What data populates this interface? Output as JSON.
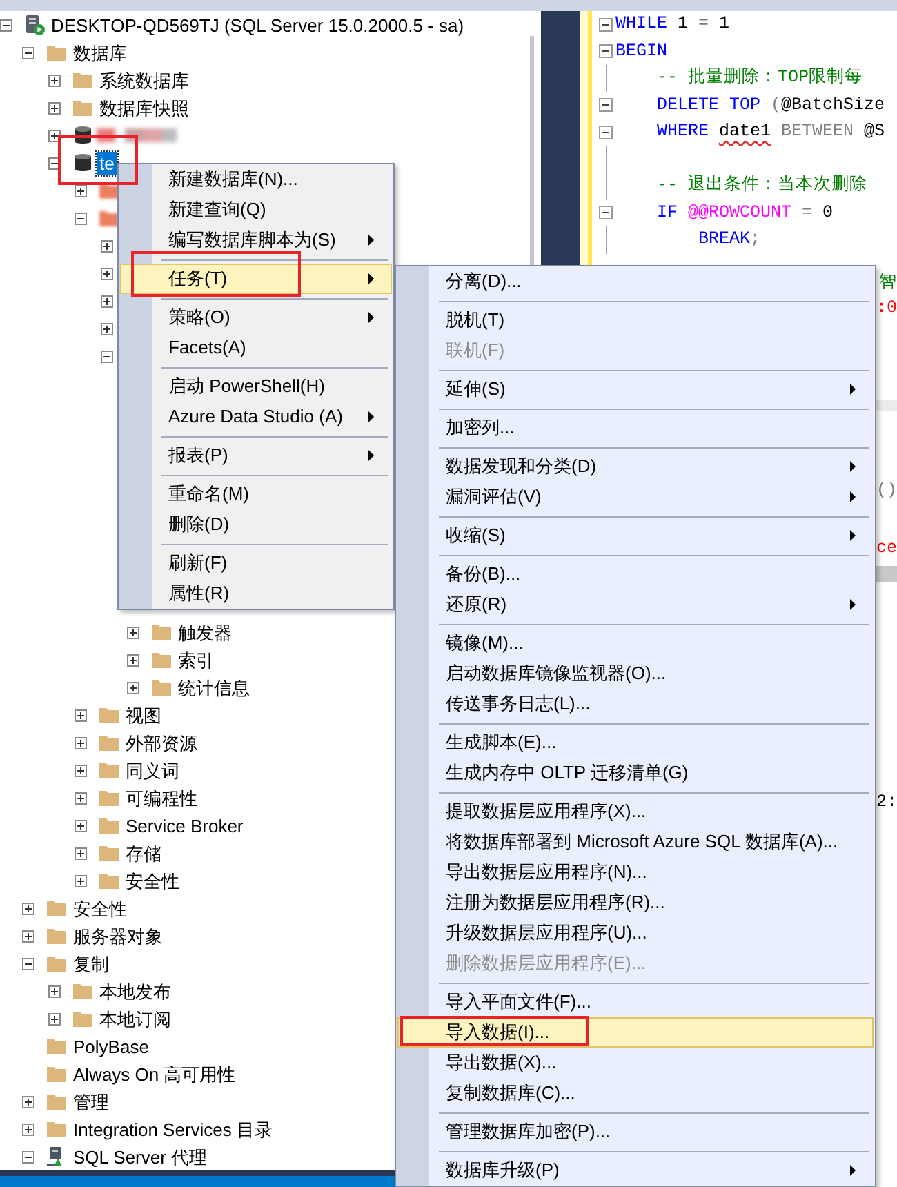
{
  "object_explorer": {
    "tree": [
      {
        "label": "DESKTOP-QD569TJ (SQL Server 15.0.2000.5 - sa)",
        "kind": "server",
        "expanded": true,
        "selected": false,
        "children": [
          {
            "label": "数据库",
            "kind": "folder",
            "expanded": true,
            "selected": false,
            "children": [
              {
                "label": "系统数据库",
                "kind": "folder",
                "expanded": false,
                "selected": false
              },
              {
                "label": "数据库快照",
                "kind": "folder",
                "expanded": false,
                "selected": false
              },
              {
                "kind": "blurreddatabase",
                "expanded": false,
                "selected": false
              },
              {
                "label": "te",
                "kind": "database",
                "expanded": true,
                "selected": true,
                "annotated": true,
                "children": [
                  {
                    "kind": "blurredfolder",
                    "expanded": false,
                    "selected": false
                  },
                  {
                    "kind": "blurredfolder",
                    "expanded": true,
                    "selected": false,
                    "children": [
                      {
                        "expanded": false,
                        "selected": false
                      },
                      {
                        "expanded": false,
                        "selected": false
                      },
                      {
                        "expanded": false,
                        "selected": false
                      },
                      {
                        "expanded": false,
                        "selected": false
                      },
                      {
                        "expanded": true,
                        "selected": false,
                        "children": [
                          {
                            "label": "触发器",
                            "kind": "folder",
                            "expanded": false,
                            "selected": false
                          },
                          {
                            "label": "索引",
                            "kind": "folder",
                            "expanded": false,
                            "selected": false
                          },
                          {
                            "label": "统计信息",
                            "kind": "folder",
                            "expanded": false,
                            "selected": false
                          }
                        ]
                      }
                    ]
                  },
                  {
                    "label": "视图",
                    "kind": "folder",
                    "expanded": false,
                    "selected": false
                  },
                  {
                    "label": "外部资源",
                    "kind": "folder",
                    "expanded": false,
                    "selected": false
                  },
                  {
                    "label": "同义词",
                    "kind": "folder",
                    "expanded": false,
                    "selected": false
                  },
                  {
                    "label": "可编程性",
                    "kind": "folder",
                    "expanded": false,
                    "selected": false
                  },
                  {
                    "label": "Service Broker",
                    "kind": "folder",
                    "expanded": false,
                    "selected": false
                  },
                  {
                    "label": "存储",
                    "kind": "folder",
                    "expanded": false,
                    "selected": false
                  },
                  {
                    "label": "安全性",
                    "kind": "folder",
                    "expanded": false,
                    "selected": false
                  }
                ]
              }
            ]
          },
          {
            "label": "安全性",
            "kind": "folder",
            "expanded": false,
            "selected": false
          },
          {
            "label": "服务器对象",
            "kind": "folder",
            "expanded": false,
            "selected": false
          },
          {
            "label": "复制",
            "kind": "folder",
            "expanded": true,
            "selected": false,
            "children": [
              {
                "label": "本地发布",
                "kind": "folder",
                "expanded": false,
                "selected": false
              },
              {
                "label": "本地订阅",
                "kind": "folder",
                "expanded": false,
                "selected": false
              }
            ]
          },
          {
            "label": "PolyBase",
            "kind": "folder",
            "selected": false
          },
          {
            "label": "Always On 高可用性",
            "kind": "folder",
            "selected": false
          },
          {
            "label": "管理",
            "kind": "folder",
            "expanded": false,
            "selected": false
          },
          {
            "label": "Integration Services 目录",
            "kind": "folder",
            "expanded": false,
            "selected": false
          },
          {
            "label": "SQL Server 代理",
            "kind": "agent",
            "expanded": true,
            "selected": false
          }
        ]
      }
    ]
  },
  "editor": {
    "lines": [
      {
        "fold": true,
        "tokens": [
          {
            "t": "WHILE",
            "kind": "keyword"
          },
          {
            "t": " 1 ",
            "kind": "plain"
          },
          {
            "t": "=",
            "kind": "operator"
          },
          {
            "t": " 1",
            "kind": "plain"
          }
        ]
      },
      {
        "fold": true,
        "tokens": [
          {
            "t": "BEGIN",
            "kind": "keyword"
          }
        ]
      },
      {
        "fold": false,
        "tokens": [
          {
            "t": "    -- 批量删除：TOP限制每",
            "kind": "comment"
          }
        ]
      },
      {
        "fold": true,
        "tokens": [
          {
            "t": "    DELETE TOP",
            "kind": "keyword"
          },
          {
            "t": " (",
            "kind": "operator"
          },
          {
            "t": "@BatchSize",
            "kind": "plain"
          }
        ]
      },
      {
        "fold": true,
        "tokens": [
          {
            "t": "    WHERE ",
            "kind": "keyword"
          },
          {
            "t": "date1",
            "kind": "plain",
            "squiggle": true
          },
          {
            "t": " BETWEEN",
            "kind": "operator"
          },
          {
            "t": " @S",
            "kind": "plain"
          }
        ]
      },
      {
        "fold": false
      },
      {
        "fold": false,
        "tokens": [
          {
            "t": "    -- 退出条件：当本次删除",
            "kind": "comment"
          }
        ]
      },
      {
        "fold": true,
        "tokens": [
          {
            "t": "    IF ",
            "kind": "keyword"
          },
          {
            "t": "@@ROWCOUNT",
            "kind": "system"
          },
          {
            "t": " = ",
            "kind": "operator"
          },
          {
            "t": "0",
            "kind": "plain"
          }
        ]
      },
      {
        "fold": false,
        "tokens": [
          {
            "t": "        BREAK",
            "kind": "keyword"
          },
          {
            "t": ";",
            "kind": "operator"
          }
        ]
      }
    ],
    "fragments": [
      {
        "t": "智",
        "kind": "comment"
      },
      {
        "t": ":0",
        "kind": "string"
      },
      {
        "t": "()",
        "kind": "operator"
      },
      {
        "t": "ce",
        "kind": "string"
      },
      {
        "t": "2:",
        "kind": "plain"
      }
    ]
  },
  "context_menus": [
    {
      "groups": [
        [
          {
            "label": "新建数据库(N)...",
            "submenu": false,
            "disabled": false,
            "selected": false
          },
          {
            "label": "新建查询(Q)",
            "submenu": false,
            "disabled": false,
            "selected": false
          },
          {
            "label": "编写数据库脚本为(S)",
            "submenu": true,
            "disabled": false,
            "selected": false
          }
        ],
        [
          {
            "label": "任务(T)",
            "submenu": true,
            "disabled": false,
            "selected": true,
            "annotated": true
          }
        ],
        [
          {
            "label": "策略(O)",
            "submenu": true,
            "disabled": false,
            "selected": false
          },
          {
            "label": "Facets(A)",
            "submenu": false,
            "disabled": false,
            "selected": false
          }
        ],
        [
          {
            "label": "启动 PowerShell(H)",
            "submenu": false,
            "disabled": false,
            "selected": false
          },
          {
            "label": "Azure Data Studio (A)",
            "submenu": true,
            "disabled": false,
            "selected": false
          }
        ],
        [
          {
            "label": "报表(P)",
            "submenu": true,
            "disabled": false,
            "selected": false
          }
        ],
        [
          {
            "label": "重命名(M)",
            "submenu": false,
            "disabled": false,
            "selected": false
          },
          {
            "label": "删除(D)",
            "submenu": false,
            "disabled": false,
            "selected": false
          }
        ],
        [
          {
            "label": "刷新(F)",
            "submenu": false,
            "disabled": false,
            "selected": false
          },
          {
            "label": "属性(R)",
            "submenu": false,
            "disabled": false,
            "selected": false
          }
        ]
      ]
    },
    {
      "groups": [
        [
          {
            "label": "分离(D)...",
            "submenu": false,
            "disabled": false,
            "selected": false
          }
        ],
        [
          {
            "label": "脱机(T)",
            "submenu": false,
            "disabled": false,
            "selected": false
          },
          {
            "label": "联机(F)",
            "submenu": false,
            "disabled": true,
            "selected": false
          }
        ],
        [
          {
            "label": "延伸(S)",
            "submenu": true,
            "disabled": false,
            "selected": false
          }
        ],
        [
          {
            "label": "加密列...",
            "submenu": false,
            "disabled": false,
            "selected": false
          }
        ],
        [
          {
            "label": "数据发现和分类(D)",
            "submenu": true,
            "disabled": false,
            "selected": false
          },
          {
            "label": "漏洞评估(V)",
            "submenu": true,
            "disabled": false,
            "selected": false
          }
        ],
        [
          {
            "label": "收缩(S)",
            "submenu": true,
            "disabled": false,
            "selected": false
          }
        ],
        [
          {
            "label": "备份(B)...",
            "submenu": false,
            "disabled": false,
            "selected": false
          },
          {
            "label": "还原(R)",
            "submenu": true,
            "disabled": false,
            "selected": false
          }
        ],
        [
          {
            "label": "镜像(M)...",
            "submenu": false,
            "disabled": false,
            "selected": false
          },
          {
            "label": "启动数据库镜像监视器(O)...",
            "submenu": false,
            "disabled": false,
            "selected": false
          },
          {
            "label": "传送事务日志(L)...",
            "submenu": false,
            "disabled": false,
            "selected": false
          }
        ],
        [
          {
            "label": "生成脚本(E)...",
            "submenu": false,
            "disabled": false,
            "selected": false
          },
          {
            "label": "生成内存中 OLTP 迁移清单(G)",
            "submenu": false,
            "disabled": false,
            "selected": false
          }
        ],
        [
          {
            "label": "提取数据层应用程序(X)...",
            "submenu": false,
            "disabled": false,
            "selected": false
          },
          {
            "label": "将数据库部署到 Microsoft Azure SQL 数据库(A)...",
            "submenu": false,
            "disabled": false,
            "selected": false
          },
          {
            "label": "导出数据层应用程序(N)...",
            "submenu": false,
            "disabled": false,
            "selected": false
          },
          {
            "label": "注册为数据层应用程序(R)...",
            "submenu": false,
            "disabled": false,
            "selected": false
          },
          {
            "label": "升级数据层应用程序(U)...",
            "submenu": false,
            "disabled": false,
            "selected": false
          },
          {
            "label": "删除数据层应用程序(E)...",
            "submenu": false,
            "disabled": true,
            "selected": false
          }
        ],
        [
          {
            "label": "导入平面文件(F)...",
            "submenu": false,
            "disabled": false,
            "selected": false
          },
          {
            "label": "导入数据(I)...",
            "submenu": false,
            "disabled": false,
            "selected": true,
            "annotated": true
          },
          {
            "label": "导出数据(X)...",
            "submenu": false,
            "disabled": false,
            "selected": false
          },
          {
            "label": "复制数据库(C)...",
            "submenu": false,
            "disabled": false,
            "selected": false
          }
        ],
        [
          {
            "label": "管理数据库加密(P)...",
            "submenu": false,
            "disabled": false,
            "selected": false
          }
        ],
        [
          {
            "label": "数据库升级(P)",
            "submenu": true,
            "disabled": false,
            "selected": false
          }
        ]
      ]
    }
  ]
}
